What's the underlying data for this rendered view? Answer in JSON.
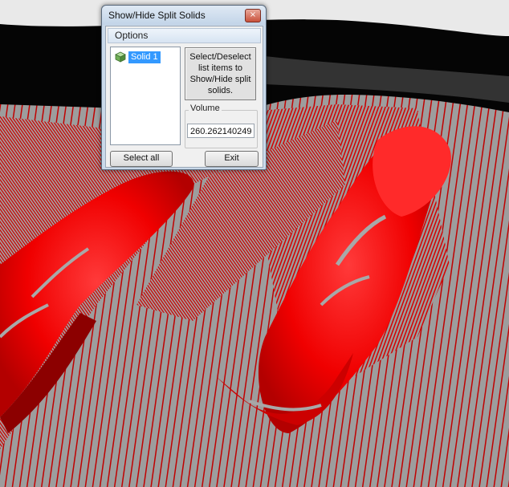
{
  "window": {
    "title": "Show/Hide Split Solids",
    "close_glyph": "×"
  },
  "options": {
    "header": "Options",
    "list_items": [
      {
        "label": "Solid 1",
        "icon": "cube-icon",
        "selected": true
      }
    ],
    "info_text": "Select/Deselect list items to Show/Hide split solids.",
    "volume": {
      "label": "Volume",
      "value": "260.262140249"
    },
    "select_all_label": "Select all",
    "exit_label": "Exit"
  },
  "colors": {
    "solid_red": "#f00000",
    "mesh_gray": "#9a9a9a",
    "selection_blue": "#3399ff"
  }
}
